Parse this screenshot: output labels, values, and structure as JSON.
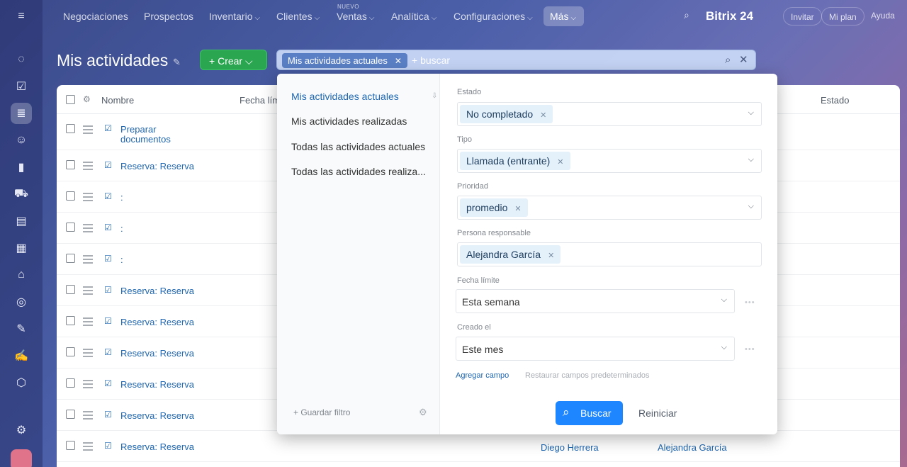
{
  "nav": {
    "items": [
      "Negociaciones",
      "Prospectos",
      "Inventario",
      "Clientes",
      "Ventas",
      "Analítica",
      "Configuraciones",
      "Más"
    ],
    "new_badge": "NUEVO",
    "brand": "Bitrix 24",
    "invite": "Invitar",
    "plan": "Mi plan",
    "help": "Ayuda"
  },
  "page": {
    "title": "Mis actividades",
    "create_label": "Crear",
    "search_chip": "Mis actividades actuales",
    "search_placeholder": "+ buscar"
  },
  "grid": {
    "columns": [
      "Nombre",
      "Fecha lím",
      "Estado"
    ],
    "rows": [
      {
        "name": "Preparar documentos",
        "resp": "",
        "person": ""
      },
      {
        "name": "Reserva: Reserva",
        "resp": "",
        "person": ""
      },
      {
        "name": ":",
        "resp": "",
        "person": ""
      },
      {
        "name": ":",
        "resp": "",
        "person": ""
      },
      {
        "name": ":",
        "resp": "",
        "person": ""
      },
      {
        "name": "Reserva: Reserva",
        "resp": "",
        "person": ""
      },
      {
        "name": "Reserva: Reserva",
        "resp": "",
        "person": ""
      },
      {
        "name": "Reserva: Reserva",
        "resp": "",
        "person": ""
      },
      {
        "name": "Reserva: Reserva",
        "resp": "",
        "person": ""
      },
      {
        "name": "Reserva: Reserva",
        "resp": "",
        "person": ""
      },
      {
        "name": "Reserva: Reserva",
        "resp": "Diego Herrera",
        "person": "Alejandra García"
      }
    ]
  },
  "filter": {
    "presets": [
      "Mis actividades actuales",
      "Mis actividades realizadas",
      "Todas las actividades actuales",
      "Todas las actividades realiza..."
    ],
    "save_filter": "+ Guardar filtro",
    "fields": {
      "estado_label": "Estado",
      "estado_value": "No completado",
      "tipo_label": "Tipo",
      "tipo_value": "Llamada (entrante)",
      "prioridad_label": "Prioridad",
      "prioridad_value": "promedio",
      "persona_label": "Persona responsable",
      "persona_value": "Alejandra García",
      "fecha_label": "Fecha límite",
      "fecha_value": "Esta semana",
      "creado_label": "Creado el",
      "creado_value": "Este mes"
    },
    "add_field": "Agregar campo",
    "restore_fields": "Restaurar campos predeterminados",
    "search_button": "Buscar",
    "reset_button": "Reiniciar"
  }
}
